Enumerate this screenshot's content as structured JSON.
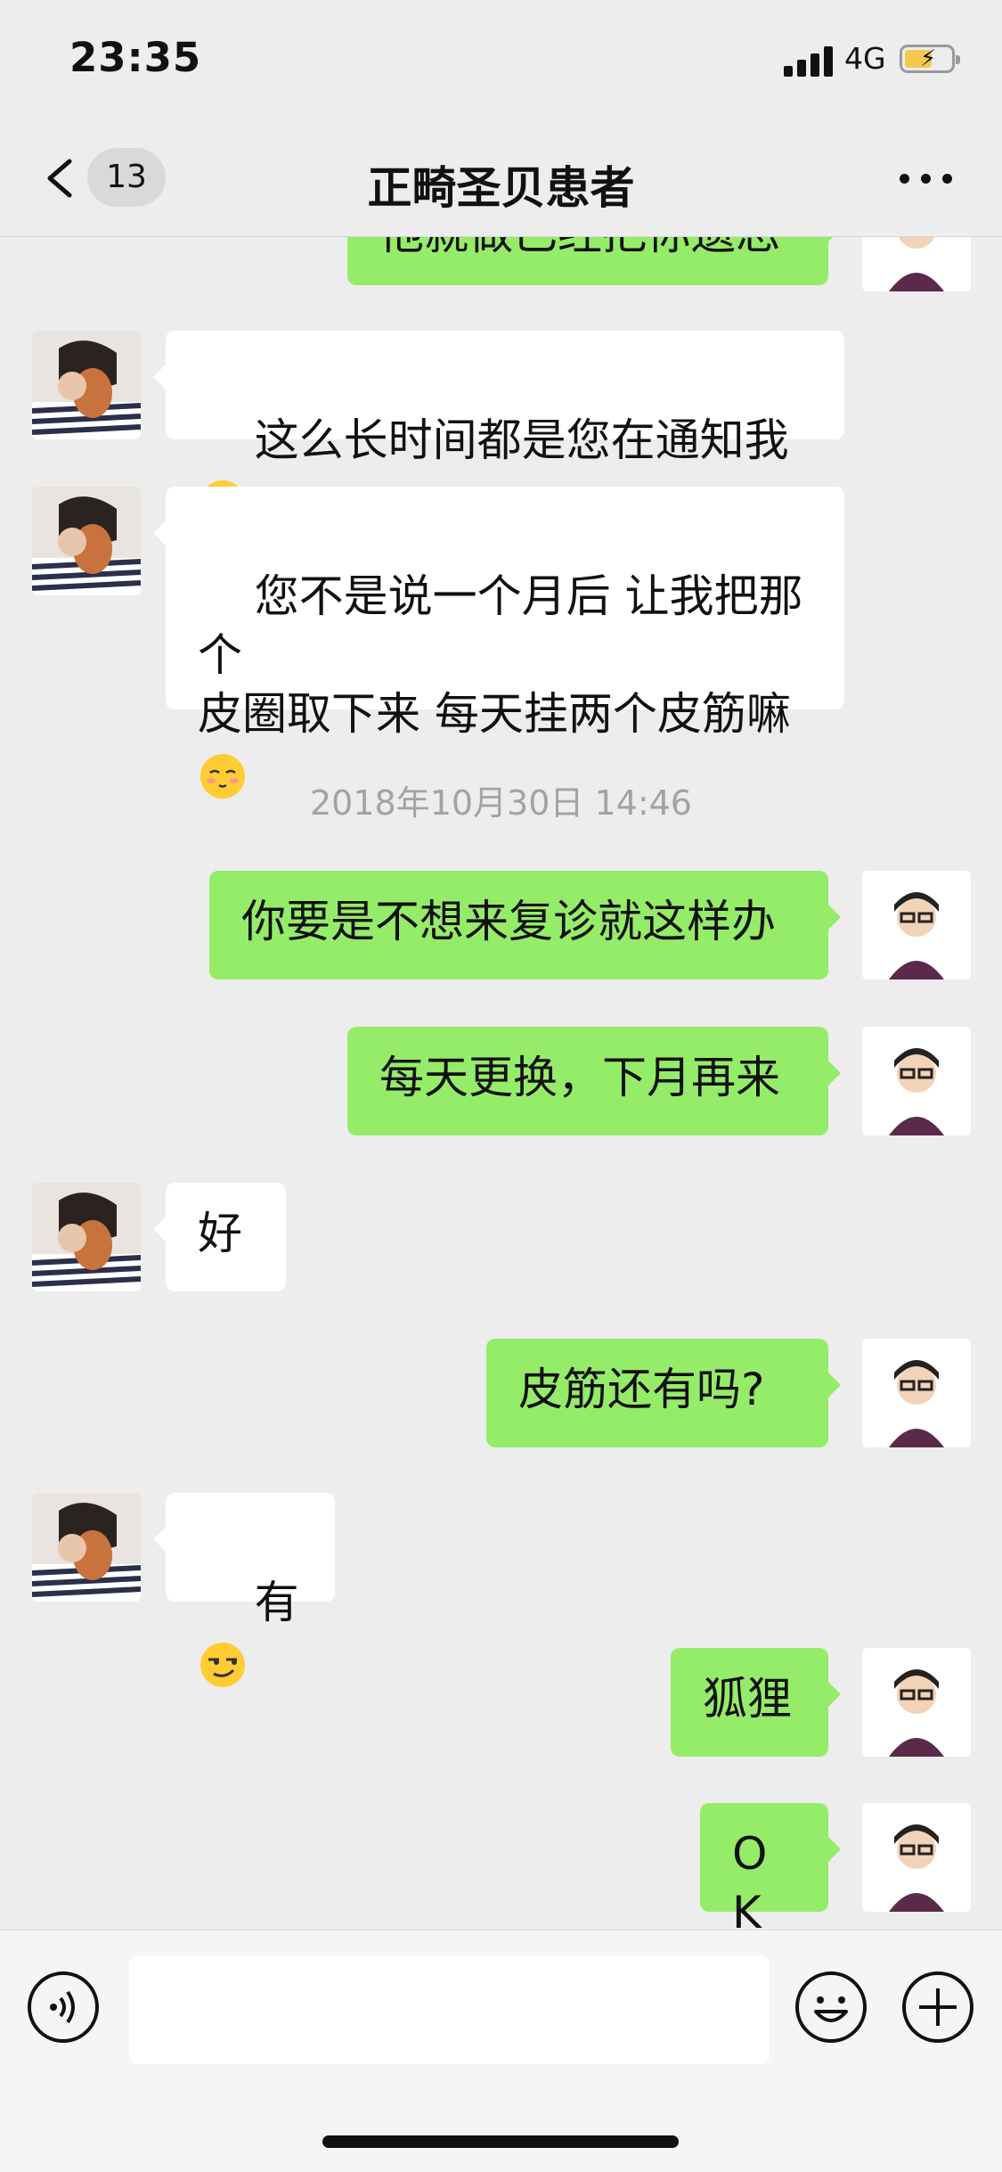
{
  "status_bar": {
    "time": "23:35",
    "network": "4G",
    "battery_percent": 60
  },
  "nav": {
    "back_badge": "13",
    "title": "正畸圣贝患者",
    "more_icon": "more-dots-icon"
  },
  "chat": {
    "partial_top_message": "他就做已经把你遗忘",
    "messages": [
      {
        "side": "left",
        "text": "这么长时间都是您在通知我",
        "emoji": "dizzy-face-emoji"
      },
      {
        "side": "left",
        "text": "您不是说一个月后 让我把那个\n皮圈取下来 每天挂两个皮筋嘛\n",
        "emoji": "blushing-face-emoji"
      },
      {
        "side": "right",
        "text": "你要是不想来复诊就这样办"
      },
      {
        "side": "right",
        "text": "每天更换，下月再来"
      },
      {
        "side": "left",
        "text": "好"
      },
      {
        "side": "right",
        "text": "皮筋还有吗?"
      },
      {
        "side": "left",
        "text": "有",
        "emoji": "smirking-face-emoji"
      },
      {
        "side": "right",
        "text": "狐狸"
      },
      {
        "side": "right",
        "text": "OK"
      }
    ],
    "timestamp": "2018年10月30日 14:46"
  },
  "input_bar": {
    "placeholder": "",
    "voice_icon": "voice-icon",
    "emoji_icon": "emoji-icon",
    "plus_icon": "plus-icon"
  },
  "colors": {
    "background": "#ededed",
    "sent_bubble": "#95ec69",
    "received_bubble": "#ffffff",
    "battery": "#f2c94c"
  }
}
